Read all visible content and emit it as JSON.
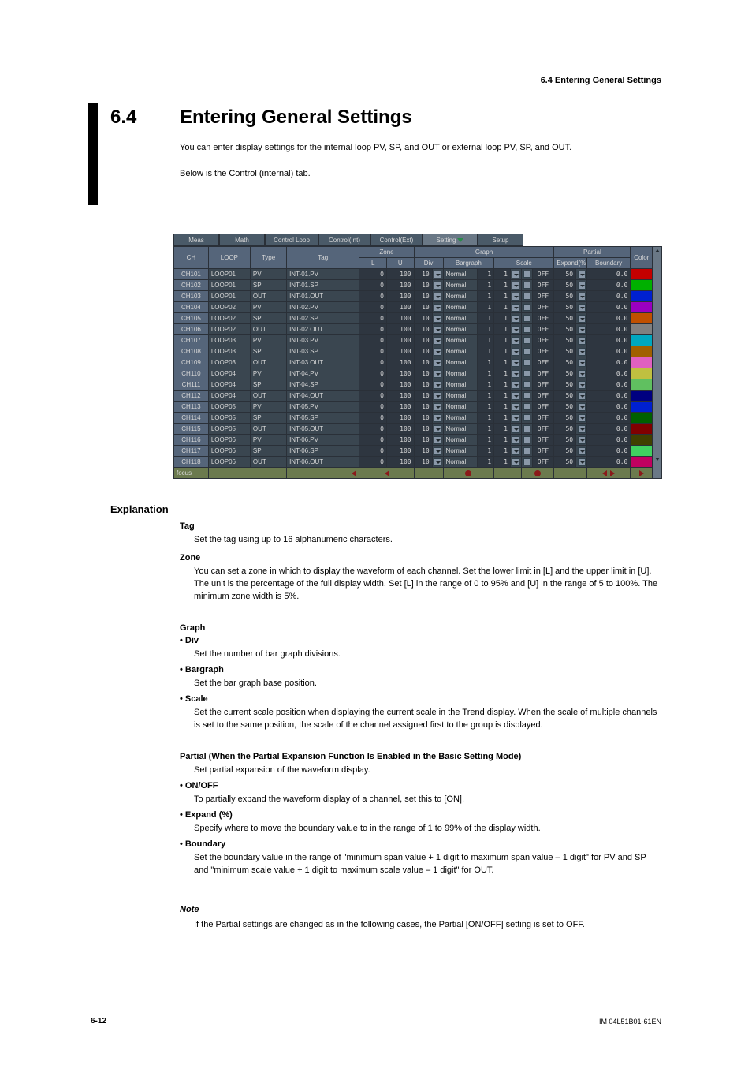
{
  "header": {
    "right": "6.4  Entering General Settings"
  },
  "section": {
    "number": "6.4",
    "title": "Entering General Settings"
  },
  "intro": [
    "You can enter display settings for the internal loop PV, SP, and OUT or external loop PV, SP, and OUT.",
    "Below is the Control (internal) tab."
  ],
  "tabs": {
    "meas": "Meas",
    "math": "Math",
    "ctrl_loop": "Control Loop",
    "ctrl_int": "Control(Int)",
    "ctrl_ext": "Control(Ext)",
    "setting": "Setting",
    "setup": "Setup"
  },
  "columns": {
    "ch": "CH",
    "loop": "LOOP",
    "type": "Type",
    "tag": "Tag",
    "zone": "Zone",
    "zone_l": "L",
    "zone_u": "U",
    "graph": "Graph",
    "div": "Div",
    "bargraph": "Bargraph",
    "scale": "Scale",
    "partial": "Partial",
    "expand": "Expand(%)",
    "boundary": "Boundary",
    "color": "Color"
  },
  "row_defaults": {
    "zone_l": "0",
    "zone_u": "100",
    "div_n": "10",
    "bargraph": "Normal",
    "scale_n": "1",
    "scale_g": "1",
    "scale_state": "OFF",
    "expand_n": "50",
    "boundary": "0.0"
  },
  "rows": [
    {
      "ch": "CH101",
      "loop": "LOOP01",
      "type": "PV",
      "tag": "INT-01.PV",
      "color": "#c40000"
    },
    {
      "ch": "CH102",
      "loop": "LOOP01",
      "type": "SP",
      "tag": "INT-01.SP",
      "color": "#00b000"
    },
    {
      "ch": "CH103",
      "loop": "LOOP01",
      "type": "OUT",
      "tag": "INT-01.OUT",
      "color": "#0020d0"
    },
    {
      "ch": "CH104",
      "loop": "LOOP02",
      "type": "PV",
      "tag": "INT-02.PV",
      "color": "#9a00c0"
    },
    {
      "ch": "CH105",
      "loop": "LOOP02",
      "type": "SP",
      "tag": "INT-02.SP",
      "color": "#c05000"
    },
    {
      "ch": "CH106",
      "loop": "LOOP02",
      "type": "OUT",
      "tag": "INT-02.OUT",
      "color": "#808080"
    },
    {
      "ch": "CH107",
      "loop": "LOOP03",
      "type": "PV",
      "tag": "INT-03.PV",
      "color": "#00a8c0"
    },
    {
      "ch": "CH108",
      "loop": "LOOP03",
      "type": "SP",
      "tag": "INT-03.SP",
      "color": "#a06000"
    },
    {
      "ch": "CH109",
      "loop": "LOOP03",
      "type": "OUT",
      "tag": "INT-03.OUT",
      "color": "#e060c0"
    },
    {
      "ch": "CH110",
      "loop": "LOOP04",
      "type": "PV",
      "tag": "INT-04.PV",
      "color": "#c0c040"
    },
    {
      "ch": "CH111",
      "loop": "LOOP04",
      "type": "SP",
      "tag": "INT-04.SP",
      "color": "#60c060"
    },
    {
      "ch": "CH112",
      "loop": "LOOP04",
      "type": "OUT",
      "tag": "INT-04.OUT",
      "color": "#000080"
    },
    {
      "ch": "CH113",
      "loop": "LOOP05",
      "type": "PV",
      "tag": "INT-05.PV",
      "color": "#0020d0"
    },
    {
      "ch": "CH114",
      "loop": "LOOP05",
      "type": "SP",
      "tag": "INT-05.SP",
      "color": "#006000"
    },
    {
      "ch": "CH115",
      "loop": "LOOP05",
      "type": "OUT",
      "tag": "INT-05.OUT",
      "color": "#800000"
    },
    {
      "ch": "CH116",
      "loop": "LOOP06",
      "type": "PV",
      "tag": "INT-06.PV",
      "color": "#404000"
    },
    {
      "ch": "CH117",
      "loop": "LOOP06",
      "type": "SP",
      "tag": "INT-06.SP",
      "color": "#40d060"
    },
    {
      "ch": "CH118",
      "loop": "LOOP06",
      "type": "OUT",
      "tag": "INT-06.OUT",
      "color": "#c00060"
    }
  ],
  "bottom_label": "focus",
  "explain_h": "Explanation",
  "tag_h": "Tag",
  "tag_p": "Set the tag using up to 16 alphanumeric characters.",
  "zone_h": "Zone",
  "zone_p": "You can set a zone in which to display the waveform of each channel. Set the lower limit in [L] and the upper limit in [U]. The unit is the percentage of the full display width. Set [L] in the range of 0 to 95% and [U] in the range of 5 to 100%. The minimum zone width is 5%.",
  "graph_h": "Graph",
  "div_h": "Div",
  "div_p": "Set the number of bar graph divisions.",
  "bar_h": "Bargraph",
  "bar_p": "Set the bar graph base position.",
  "scale_h": "Scale",
  "scale_p": "Set the current scale position when displaying the current scale in the Trend display. When the scale of multiple channels is set to the same position, the scale of the channel assigned first to the group is displayed.",
  "partial_h": "Partial (When the Partial Expansion Function Is Enabled in the Basic Setting Mode)",
  "partial_p": "Set partial expansion of the waveform display.",
  "onoff_h": "ON/OFF",
  "onoff_p": "To partially expand the waveform display of a channel, set this to [ON].",
  "expand_h": "Expand (%)",
  "expand_p": "Specify where to move the boundary value to in the range of 1 to 99% of the display width.",
  "bound_h": "Boundary",
  "bound_p1": "Set the boundary value in the range of \"minimum span value + 1 digit to maximum span value – 1 digit\" for PV and SP and \"minimum scale value + 1 digit to maximum scale value – 1 digit\" for OUT.",
  "note_h": "Note",
  "note_p": "If the Partial settings are changed as in the following cases, the Partial [ON/OFF] setting is set to OFF.",
  "footer": {
    "page": "6-12",
    "manual": "IM 04L51B01-61EN"
  }
}
